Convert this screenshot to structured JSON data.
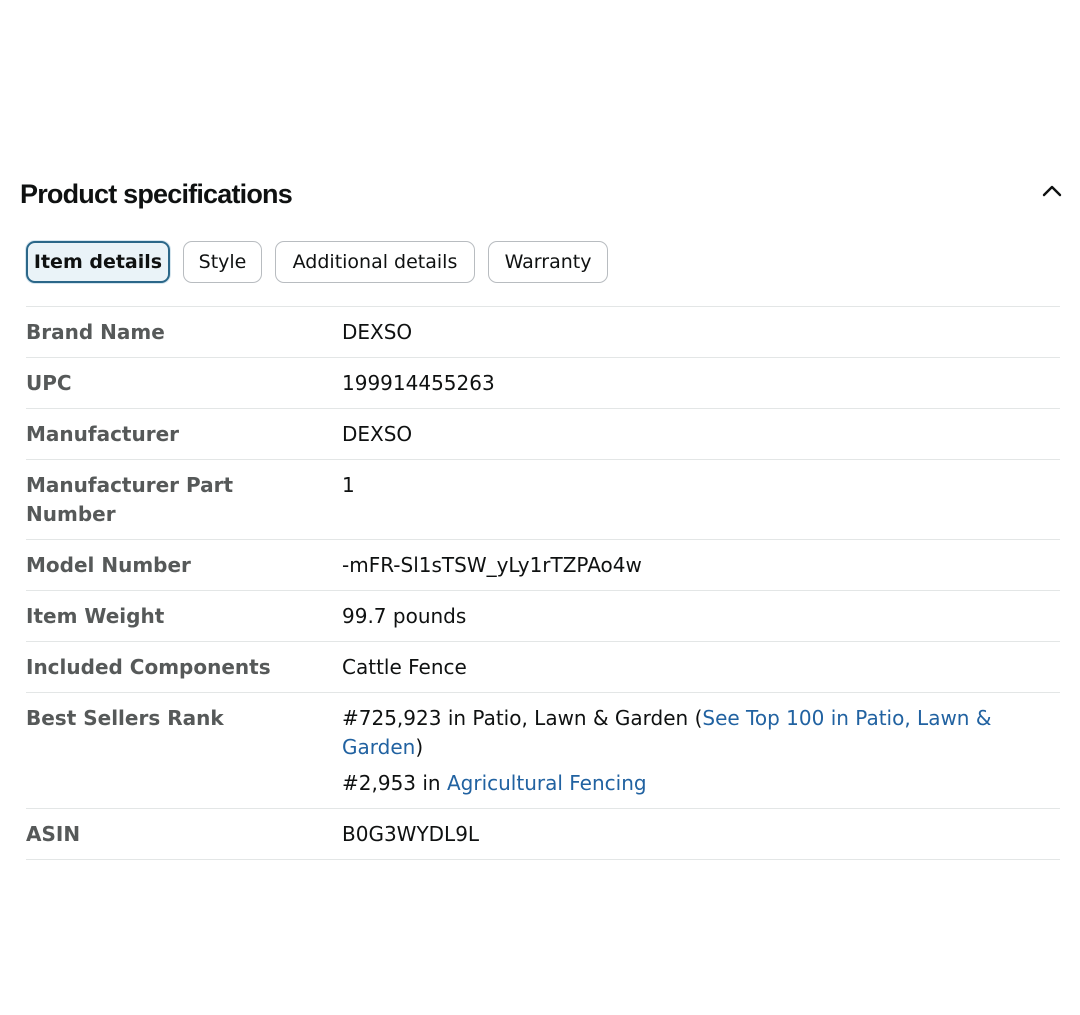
{
  "section": {
    "title": "Product specifications",
    "collapse_icon": "chevron-up-icon"
  },
  "tabs": [
    {
      "label": "Item details",
      "active": true
    },
    {
      "label": "Style",
      "active": false
    },
    {
      "label": "Additional details",
      "active": false
    },
    {
      "label": "Warranty",
      "active": false
    }
  ],
  "specs": {
    "brand_name": {
      "label": "Brand Name",
      "value": "DEXSO"
    },
    "upc": {
      "label": "UPC",
      "value": "199914455263"
    },
    "manufacturer": {
      "label": "Manufacturer",
      "value": "DEXSO"
    },
    "part_number": {
      "label": "Manufacturer Part Number",
      "value": "1"
    },
    "model_number": {
      "label": "Model Number",
      "value": "-mFR-Sl1sTSW_yLy1rTZPAo4w"
    },
    "item_weight": {
      "label": "Item Weight",
      "value": "99.7 pounds"
    },
    "included_components": {
      "label": "Included Components",
      "value": "Cattle Fence"
    },
    "best_sellers_rank": {
      "label": "Best Sellers Rank",
      "rank1_text": "#725,923 in Patio, Lawn & Garden (",
      "rank1_link": "See Top 100 in Patio, Lawn & Garden",
      "rank1_close": ")",
      "rank2_text": "#2,953 in ",
      "rank2_link": "Agricultural Fencing"
    },
    "asin": {
      "label": "ASIN",
      "value": "B0G3WYDL9L"
    }
  },
  "colors": {
    "link": "#2162a1",
    "label": "#565959",
    "active_tab_border": "#2b6789",
    "divider": "#e3e6e6"
  }
}
